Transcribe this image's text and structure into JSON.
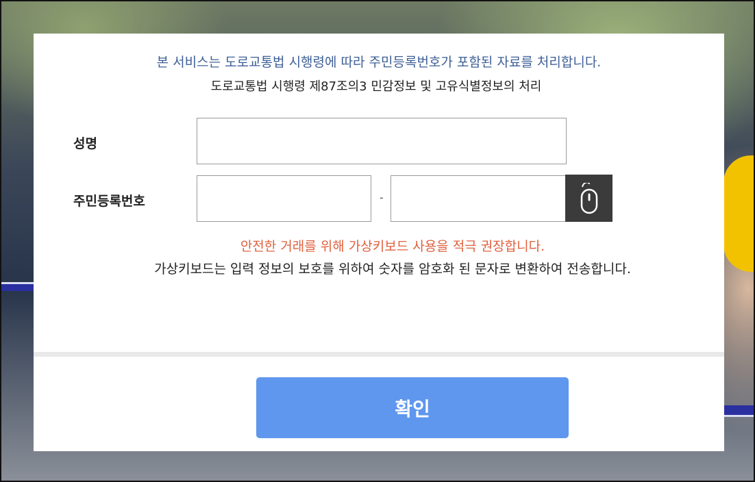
{
  "notice": {
    "main": "본 서비스는 도로교통법 시행령에 따라 주민등록번호가 포함된 자료를 처리합니다.",
    "law": "도로교통법 시행령 제87조의3 민감정보 및 고유식별정보의 처리"
  },
  "form": {
    "name_label": "성명",
    "name_value": "",
    "rrn_label": "주민등록번호",
    "rrn_front_value": "",
    "rrn_separator": "-",
    "rrn_back_value": "",
    "virtual_keyboard_icon": "mouse-icon"
  },
  "messages": {
    "warning": "안전한 거래를 위해 가상키보드 사용을 적극 권장합니다.",
    "info": "가상키보드는 입력 정보의 보호를 위하여 숫자를 암호화 된 문자로 변환하여 전송합니다."
  },
  "actions": {
    "confirm_label": "확인"
  },
  "colors": {
    "notice_blue": "#3e5f97",
    "warning_orange": "#e0603e",
    "button_blue": "#5f97ee"
  }
}
